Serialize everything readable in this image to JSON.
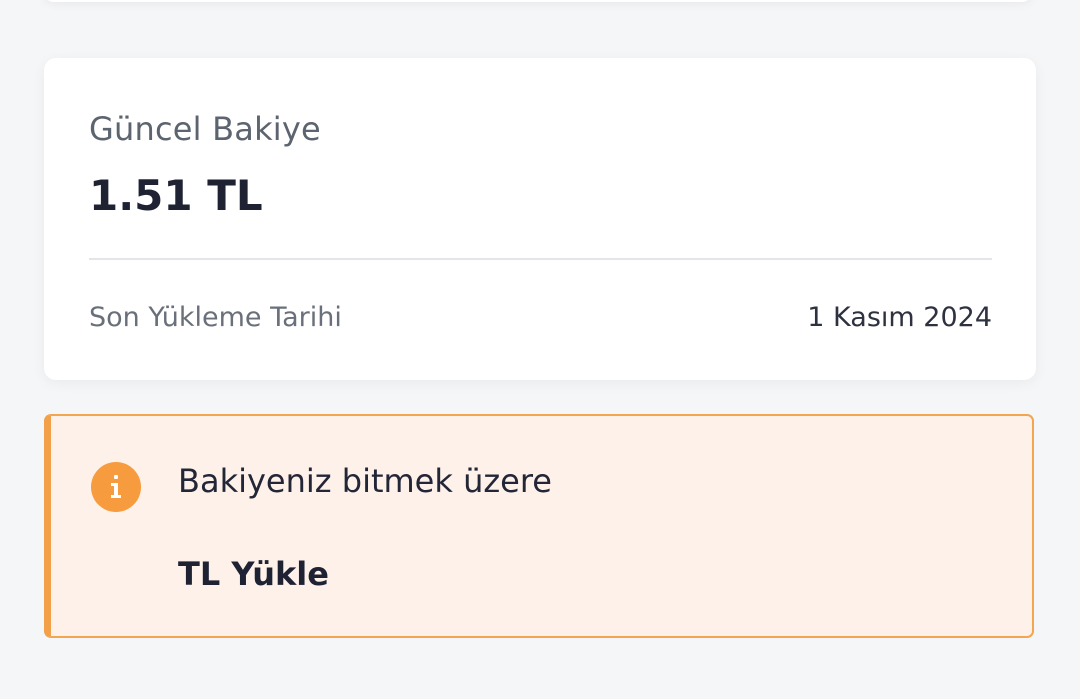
{
  "balance_card": {
    "label": "Güncel Bakiye",
    "amount": "1.51 TL",
    "last_load_label": "Son Yükleme Tarihi",
    "last_load_date": "1 Kasım 2024"
  },
  "warning": {
    "icon": "info-icon",
    "message": "Bakiyeniz bitmek üzere",
    "action_label": "TL Yükle",
    "accent_color": "#f2a04a",
    "background_color": "#fdf1ea"
  }
}
